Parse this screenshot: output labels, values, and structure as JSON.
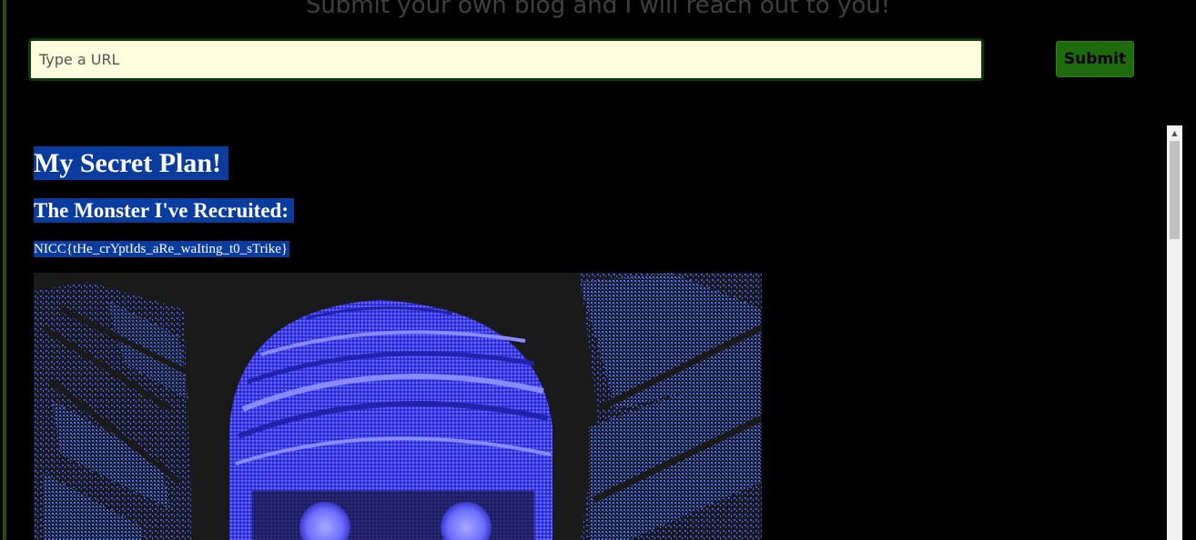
{
  "header": {
    "tagline": "Submit your own blog and I will reach out to you!"
  },
  "form": {
    "url_placeholder": "Type a URL",
    "submit_label": "Submit"
  },
  "blog": {
    "title": "My Secret Plan!",
    "subtitle": "The Monster I've Recruited:",
    "flag_text": "NICC{tHe_crYptIds_aRe_waIting_t0_sTrike}"
  },
  "colors": {
    "page_background": "#000000",
    "input_background": "#ffffe0",
    "button_background": "#1e6b0f",
    "selection_highlight": "#0a3ca0",
    "image_primary": "#5d5dff"
  },
  "icons": {
    "scroll_up": "scroll-up-arrow-icon"
  }
}
